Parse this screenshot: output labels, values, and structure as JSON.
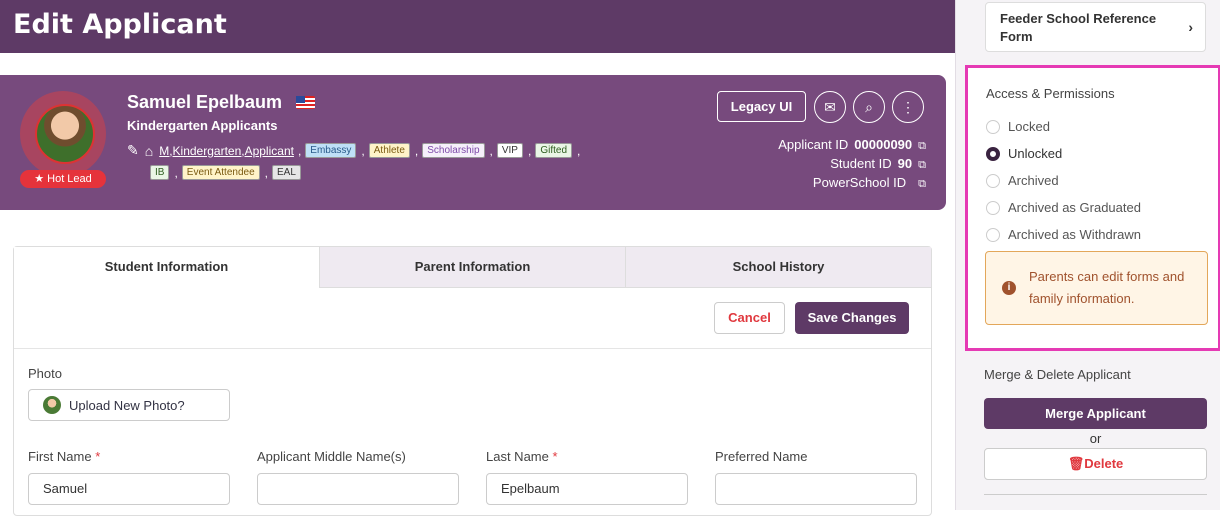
{
  "page": {
    "title": "Edit Applicant"
  },
  "applicant": {
    "name": "Samuel Epelbaum",
    "group": "Kindergarten Applicants",
    "hot_lead": "★ Hot Lead",
    "tag_text": "M,Kindergarten,Applicant",
    "tags_row1": [
      "Embassy",
      "Athlete",
      "Scholarship",
      "VIP",
      "Gifted"
    ],
    "tags_row2": [
      "IB",
      "Event Attendee",
      "EAL"
    ],
    "ids": [
      {
        "label": "Applicant ID",
        "value": "00000090"
      },
      {
        "label": "Student ID",
        "value": "90"
      },
      {
        "label": "PowerSchool ID",
        "value": ""
      }
    ]
  },
  "header_actions": {
    "legacy_label": "Legacy UI"
  },
  "tabs": [
    "Student Information",
    "Parent Information",
    "School History"
  ],
  "form": {
    "cancel_label": "Cancel",
    "save_label": "Save Changes",
    "photo_label": "Photo",
    "upload_label": "Upload New Photo?",
    "fields": [
      {
        "label": "First Name",
        "required": "*",
        "value": "Samuel"
      },
      {
        "label": "Applicant Middle Name(s)",
        "required": "",
        "value": ""
      },
      {
        "label": "Last Name",
        "required": "*",
        "value": "Epelbaum"
      },
      {
        "label": "Preferred Name",
        "required": "",
        "value": ""
      }
    ]
  },
  "sidebar": {
    "feeder_label": "Feeder School Reference Form",
    "permissions": {
      "title": "Access & Permissions",
      "options": [
        "Locked",
        "Unlocked",
        "Archived",
        "Archived as Graduated",
        "Archived as Withdrawn"
      ],
      "selected": "Unlocked",
      "notice": "Parents can edit forms and family information."
    },
    "merge": {
      "title": "Merge & Delete Applicant",
      "merge_label": "Merge Applicant",
      "or_label": "or",
      "delete_label": "Delete"
    }
  }
}
